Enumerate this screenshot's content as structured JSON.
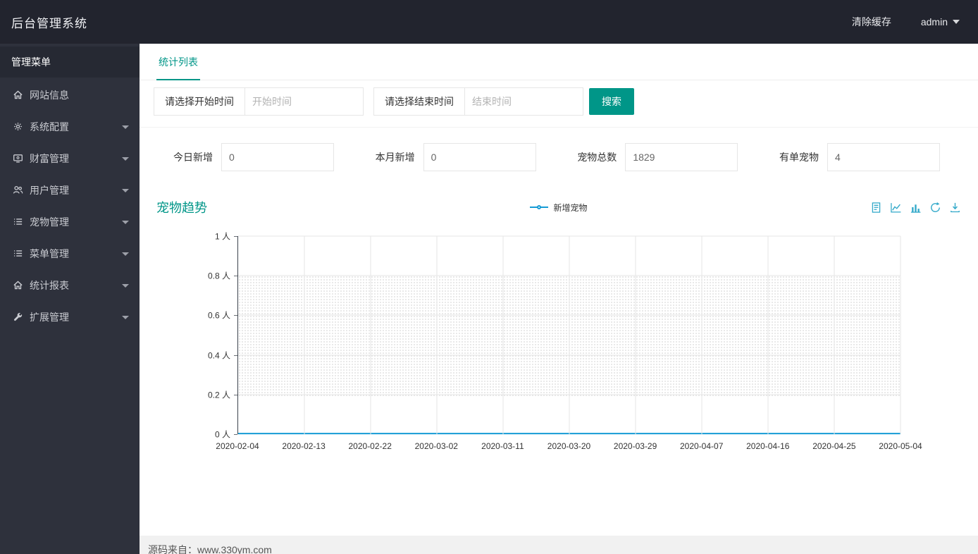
{
  "topbar": {
    "title": "后台管理系统",
    "clear_cache": "清除缓存",
    "user": "admin"
  },
  "sidebar": {
    "header": "管理菜单",
    "items": [
      {
        "id": "site-info",
        "label": "网站信息",
        "icon": "home-icon",
        "has_submenu": false
      },
      {
        "id": "system-config",
        "label": "系统配置",
        "icon": "gears-icon",
        "has_submenu": true
      },
      {
        "id": "wealth-management",
        "label": "财富管理",
        "icon": "wealth-icon",
        "has_submenu": true
      },
      {
        "id": "user-management",
        "label": "用户管理",
        "icon": "users-icon",
        "has_submenu": true
      },
      {
        "id": "pet-management",
        "label": "宠物管理",
        "icon": "list-icon",
        "has_submenu": true
      },
      {
        "id": "menu-management",
        "label": "菜单管理",
        "icon": "list-icon",
        "has_submenu": true
      },
      {
        "id": "statistics-report",
        "label": "统计报表",
        "icon": "home-icon",
        "has_submenu": true
      },
      {
        "id": "extension-management",
        "label": "扩展管理",
        "icon": "wrench-icon",
        "has_submenu": true
      }
    ]
  },
  "tabs": {
    "active": "统计列表"
  },
  "filters": {
    "start_label": "请选择开始时间",
    "start_placeholder": "开始时间",
    "end_label": "请选择结束时间",
    "end_placeholder": "结束时间",
    "search_button": "搜索"
  },
  "stats": {
    "items": [
      {
        "label": "今日新增",
        "value": "0"
      },
      {
        "label": "本月新增",
        "value": "0"
      },
      {
        "label": "宠物总数",
        "value": "1829"
      },
      {
        "label": "有单宠物",
        "value": "4"
      }
    ]
  },
  "chart": {
    "toolbox": [
      "data-view",
      "line-chart",
      "bar-chart",
      "refresh",
      "download"
    ]
  },
  "chart_data": {
    "type": "line",
    "title": "宠物趋势",
    "legend": [
      "新增宠物"
    ],
    "x": [
      "2020-02-04",
      "2020-02-13",
      "2020-02-22",
      "2020-03-02",
      "2020-03-11",
      "2020-03-20",
      "2020-03-29",
      "2020-04-07",
      "2020-04-16",
      "2020-04-25",
      "2020-05-04"
    ],
    "series": [
      {
        "name": "新增宠物",
        "values": [
          0,
          0,
          0,
          0,
          0,
          0,
          0,
          0,
          0,
          0,
          0
        ]
      }
    ],
    "ylabels": [
      "1 人",
      "0.8 人",
      "0.6 人",
      "0.4 人",
      "0.2 人",
      "0 人"
    ],
    "ylim": [
      0,
      1
    ],
    "yunit": "人",
    "line_color": "#169bd5",
    "grid": true,
    "legend_position": "top-center"
  },
  "colors": {
    "accent": "#009688",
    "topbar_bg": "#22242e",
    "sidebar_bg": "#2e313c",
    "line": "#169bd5",
    "toolbox_icons": "#31a8c9"
  },
  "footer": {
    "text": "源码来自：www.330ym.com"
  }
}
